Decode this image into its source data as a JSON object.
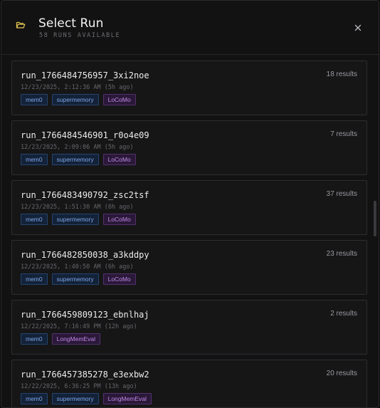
{
  "header": {
    "title": "Select Run",
    "subtitle": "58 RUNS AVAILABLE",
    "icon": "folder-open-icon",
    "close_icon": "close-icon"
  },
  "colors": {
    "accent_icon": "#e6c84f",
    "tag_blue_text": "#7fa7e8",
    "tag_purple_text": "#c18ae8"
  },
  "runs": [
    {
      "name": "run_1766484756957_3xi2noe",
      "date": "12/23/2025, 2:12:36 AM (5h ago)",
      "results": "18 results",
      "tags": [
        {
          "label": "mem0",
          "color": "blue"
        },
        {
          "label": "supermemory",
          "color": "blue"
        },
        {
          "label": "LoCoMo",
          "color": "purple"
        }
      ]
    },
    {
      "name": "run_1766484546901_r0o4e09",
      "date": "12/23/2025, 2:09:06 AM (5h ago)",
      "results": "7 results",
      "tags": [
        {
          "label": "mem0",
          "color": "blue"
        },
        {
          "label": "supermemory",
          "color": "blue"
        },
        {
          "label": "LoCoMo",
          "color": "purple"
        }
      ]
    },
    {
      "name": "run_1766483490792_zsc2tsf",
      "date": "12/23/2025, 1:51:30 AM (6h ago)",
      "results": "37 results",
      "tags": [
        {
          "label": "mem0",
          "color": "blue"
        },
        {
          "label": "supermemory",
          "color": "blue"
        },
        {
          "label": "LoCoMo",
          "color": "purple"
        }
      ]
    },
    {
      "name": "run_1766482850038_a3kddpy",
      "date": "12/23/2025, 1:40:50 AM (6h ago)",
      "results": "23 results",
      "tags": [
        {
          "label": "mem0",
          "color": "blue"
        },
        {
          "label": "supermemory",
          "color": "blue"
        },
        {
          "label": "LoCoMo",
          "color": "purple"
        }
      ]
    },
    {
      "name": "run_1766459809123_ebnlhaj",
      "date": "12/22/2025, 7:16:49 PM (12h ago)",
      "results": "2 results",
      "tags": [
        {
          "label": "mem0",
          "color": "blue"
        },
        {
          "label": "LongMemEval",
          "color": "purple"
        }
      ]
    },
    {
      "name": "run_1766457385278_e3exbw2",
      "date": "12/22/2025, 6:36:25 PM (13h ago)",
      "results": "20 results",
      "tags": [
        {
          "label": "mem0",
          "color": "blue"
        },
        {
          "label": "supermemory",
          "color": "blue"
        },
        {
          "label": "LongMemEval",
          "color": "purple"
        }
      ]
    }
  ]
}
